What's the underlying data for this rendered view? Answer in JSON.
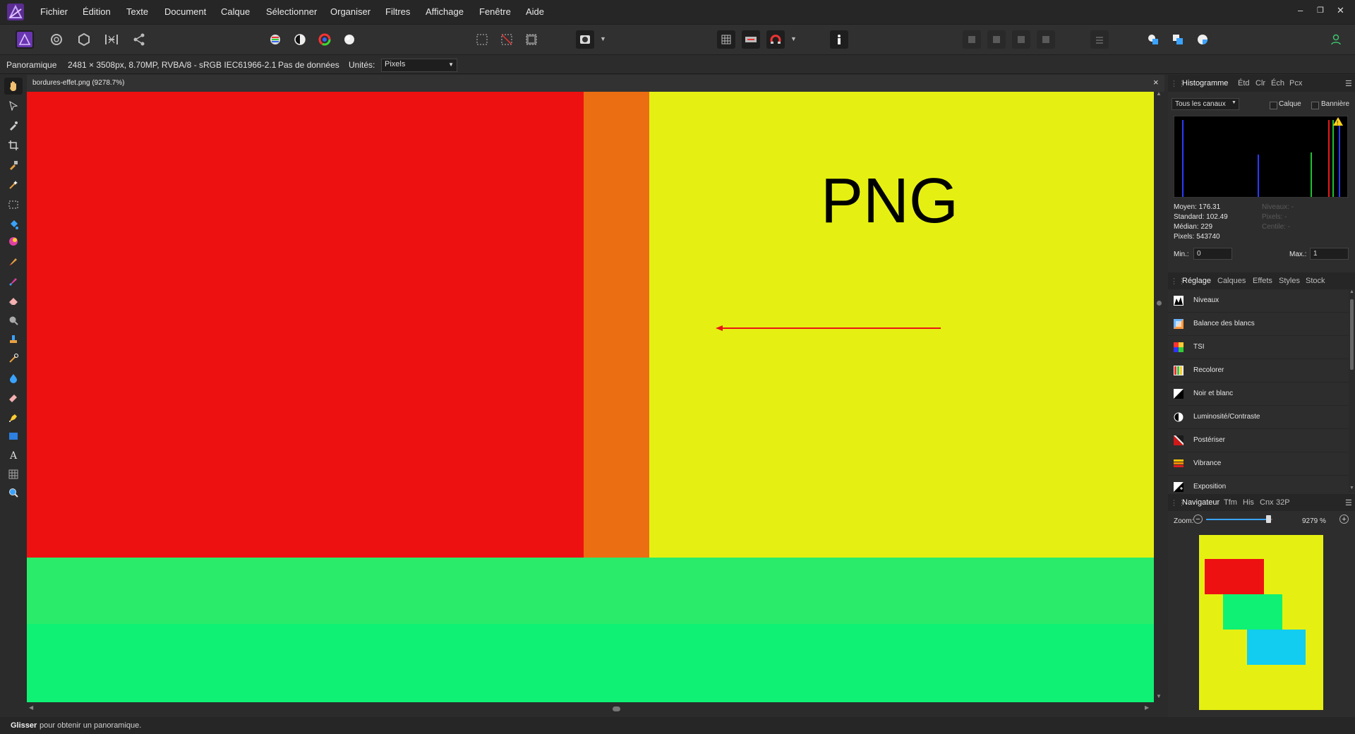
{
  "app": {
    "menu": [
      "Fichier",
      "Édition",
      "Texte",
      "Document",
      "Calque",
      "Sélectionner",
      "Organiser",
      "Filtres",
      "Affichage",
      "Fenêtre",
      "Aide"
    ]
  },
  "context_bar": {
    "tool_name": "Panoramique",
    "doc_info": "2481 × 3508px, 8.70MP, RVBA/8 - sRGB IEC61966-2.1",
    "data_status": "Pas de données",
    "units_label": "Unités:",
    "units_value": "Pixels"
  },
  "document": {
    "tab_title": "bordures-effet.png (9278.7%)",
    "close_glyph": "×",
    "canvas_text": "PNG",
    "colors": {
      "red": "#ee1111",
      "orange": "#ec6e12",
      "yellow": "#e5f012",
      "green_light": "#2bec6a",
      "green": "#0ff174",
      "cyan": "#12cdef",
      "arrow": "#e81515"
    }
  },
  "histogram_panel": {
    "tabs": [
      "Histogramme",
      "Étd",
      "Clr",
      "Éch",
      "Pcx"
    ],
    "channels": "Tous les canaux",
    "check_layer": "Calque",
    "check_banner": "Bannière",
    "stats": [
      "Moyen: 176.31",
      "Standard: 102.49",
      "Médian: 229",
      "Pixels: 543740"
    ],
    "stats_dim": [
      "Niveaux: -",
      "Pixels: -",
      "Centile: -"
    ],
    "min_label": "Min.:",
    "min_value": "0",
    "max_label": "Max.:",
    "max_value": "1"
  },
  "adjustments_panel": {
    "tabs": [
      "Réglage",
      "Calques",
      "Effets",
      "Styles",
      "Stock"
    ],
    "items": [
      "Niveaux",
      "Balance des blancs",
      "TSI",
      "Recolorer",
      "Noir et blanc",
      "Luminosité/Contraste",
      "Postériser",
      "Vibrance",
      "Exposition"
    ]
  },
  "navigator_panel": {
    "tabs": [
      "Navigateur",
      "Tfm",
      "His",
      "Cnx",
      "32P"
    ],
    "zoom_label": "Zoom:",
    "zoom_value": "9279 %",
    "zoom_level": 0.95
  },
  "status_bar": {
    "bold": "Glisser",
    "text": "pour obtenir un panoramique."
  }
}
